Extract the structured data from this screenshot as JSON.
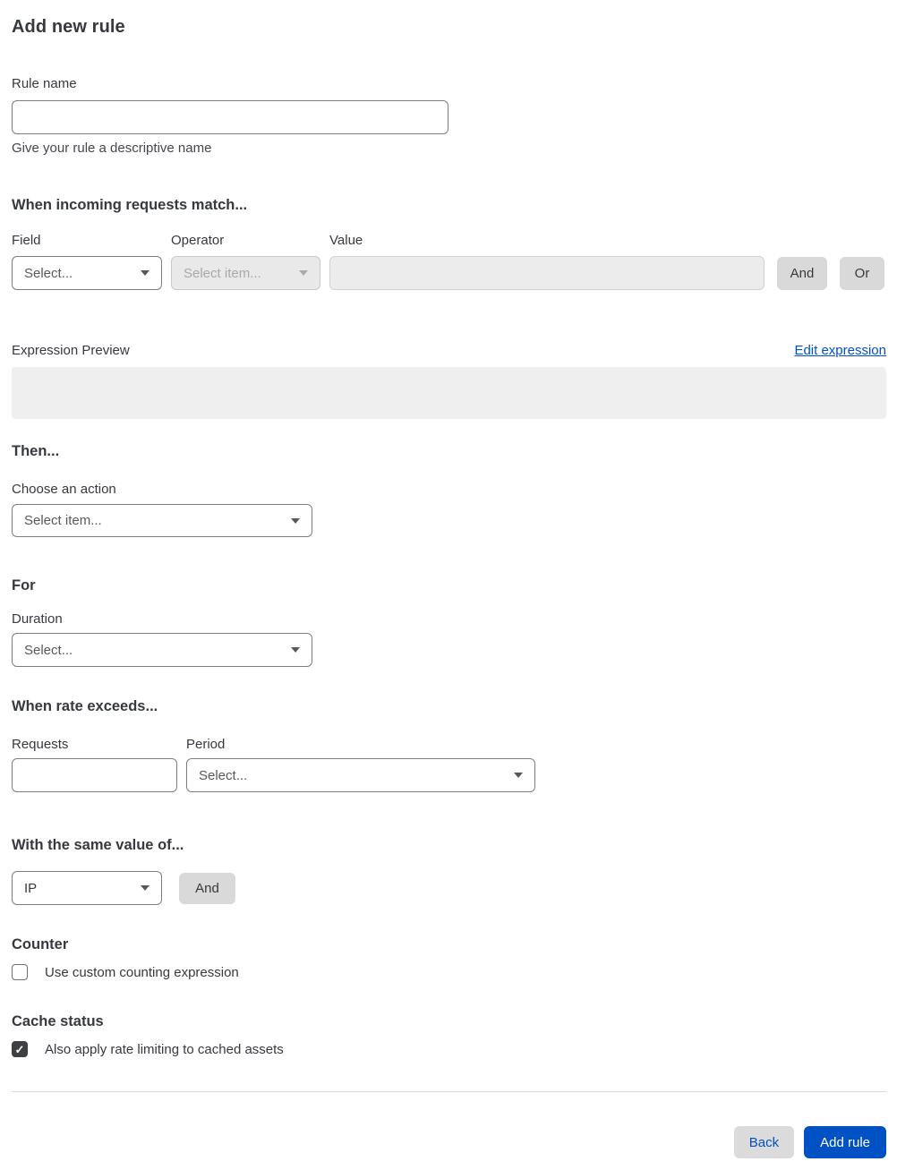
{
  "page": {
    "title": "Add new rule"
  },
  "rule_name": {
    "label": "Rule name",
    "value": "",
    "placeholder": "",
    "helper": "Give your rule a descriptive name"
  },
  "match": {
    "heading": "When incoming requests match...",
    "field": {
      "label": "Field",
      "selected": "Select..."
    },
    "operator": {
      "label": "Operator",
      "selected": "Select item...",
      "disabled": true
    },
    "value": {
      "label": "Value",
      "value": "",
      "disabled": true
    },
    "and_button": "And",
    "or_button": "Or"
  },
  "expression": {
    "label": "Expression Preview",
    "edit_link": "Edit expression",
    "content": ""
  },
  "then": {
    "heading": "Then...",
    "action_label": "Choose an action",
    "action_selected": "Select item..."
  },
  "for_section": {
    "heading": "For",
    "duration_label": "Duration",
    "duration_selected": "Select..."
  },
  "rate": {
    "heading": "When rate exceeds...",
    "requests_label": "Requests",
    "requests_value": "",
    "period_label": "Period",
    "period_selected": "Select..."
  },
  "same_value": {
    "heading": "With the same value of...",
    "characteristic_selected": "IP",
    "and_button": "And"
  },
  "counter": {
    "heading": "Counter",
    "checkbox_label": "Use custom counting expression",
    "checked": false
  },
  "cache": {
    "heading": "Cache status",
    "checkbox_label": "Also apply rate limiting to cached assets",
    "checked": true
  },
  "footer": {
    "back_button": "Back",
    "submit_button": "Add rule"
  },
  "icons": {
    "dropdown_caret": "caret-down-icon",
    "check": "checkmark-icon"
  },
  "colors": {
    "accent_blue": "#0051c3",
    "text": "#36393f",
    "disabled_bg": "#e9e9e9",
    "gray_button_bg": "#d9d9d9",
    "preview_bg": "#efefef",
    "checked_checkbox": "#3d3f43",
    "divider": "#d9d9d9"
  }
}
